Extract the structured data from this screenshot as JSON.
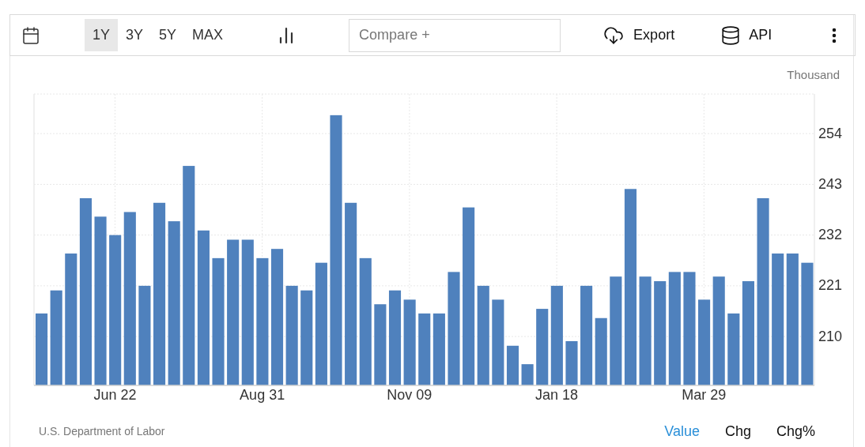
{
  "toolbar": {
    "ranges": [
      {
        "label": "1Y",
        "selected": true
      },
      {
        "label": "3Y",
        "selected": false
      },
      {
        "label": "5Y",
        "selected": false
      },
      {
        "label": "MAX",
        "selected": false
      }
    ],
    "compare": {
      "placeholder": "Compare +"
    },
    "export": "Export",
    "api": "API"
  },
  "chart": {
    "unit": "Thousand",
    "chart_data": {
      "type": "bar",
      "categories": [
        null,
        null,
        null,
        null,
        null,
        "Jun 22",
        null,
        null,
        null,
        null,
        null,
        null,
        null,
        null,
        null,
        "Aug 31",
        null,
        null,
        null,
        null,
        null,
        null,
        null,
        null,
        null,
        "Nov 09",
        null,
        null,
        null,
        null,
        null,
        null,
        null,
        null,
        null,
        "Jan 18",
        null,
        null,
        null,
        null,
        null,
        null,
        null,
        null,
        null,
        "Mar 29",
        null,
        null,
        null,
        null,
        null,
        null,
        null
      ],
      "series": [
        {
          "color": "#4f81bd",
          "values": [
            215,
            220,
            228,
            240,
            236,
            232,
            237,
            221,
            239,
            235,
            247,
            233,
            227,
            231,
            231,
            227,
            229,
            221,
            220,
            226,
            258,
            239,
            227,
            217,
            220,
            218,
            215,
            215,
            224,
            238,
            221,
            218,
            208,
            204,
            216,
            221,
            209,
            221,
            214,
            223,
            242,
            223,
            222,
            224,
            224,
            218,
            223,
            215,
            222,
            240,
            228,
            228,
            226
          ]
        }
      ],
      "ylim": [
        199.4,
        262.6
      ],
      "yticks": [
        210,
        221,
        232,
        243,
        254
      ],
      "grid": true
    }
  },
  "footer": {
    "source": "U.S. Department of Labor",
    "tabs": [
      {
        "label": "Value",
        "selected": true
      },
      {
        "label": "Chg",
        "selected": false
      },
      {
        "label": "Chg%",
        "selected": false
      }
    ]
  }
}
